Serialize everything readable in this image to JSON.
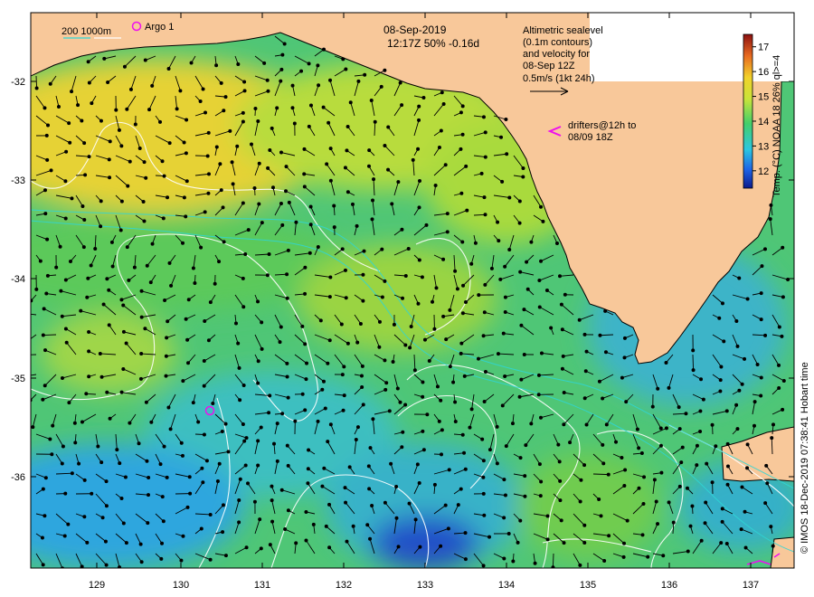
{
  "header": {
    "date": "08-Sep-2019",
    "time_line": "12:17Z  50% -0.16d"
  },
  "legend": {
    "depth_contours": "200  1000m",
    "argo": "Argo 1",
    "altimetry_lines": [
      "Altimetric sealevel",
      "(0.1m contours)",
      "and velocity for",
      "08-Sep 12Z",
      "0.5m/s (1kt 24h)"
    ],
    "drifters_lines": [
      "drifters@12h to",
      "08/09 18Z"
    ]
  },
  "axes": {
    "y_ticks": [
      "-32",
      "-33",
      "-34",
      "-35",
      "-36"
    ],
    "x_ticks": [
      "129",
      "130",
      "131",
      "132",
      "133",
      "134",
      "135",
      "136",
      "137"
    ]
  },
  "colorbar": {
    "title": "Temp. (°C) NOAA 18 26% ql>=4",
    "ticks": [
      "17",
      "16",
      "15",
      "14",
      "13",
      "12"
    ],
    "range": [
      11.3,
      17.5
    ],
    "colors": [
      "#0b1a8c",
      "#1e63e6",
      "#2cc6e0",
      "#43cf6a",
      "#c9e43a",
      "#f2d22a",
      "#e86a20",
      "#8c1010"
    ]
  },
  "credit": "© IMOS 18-Dec-2019 07:38:41 Hobart time",
  "colors": {
    "land": "#f8c89a",
    "warm": "#e9d43a",
    "mid": "#98d640",
    "green": "#44c85a",
    "cool": "#3fc2b4",
    "cold": "#2a9ae0",
    "drifter": "#ee10ee"
  },
  "icons": [
    "argo-float-icon",
    "drifter-arrow-icon",
    "velocity-arrow-icon"
  ]
}
